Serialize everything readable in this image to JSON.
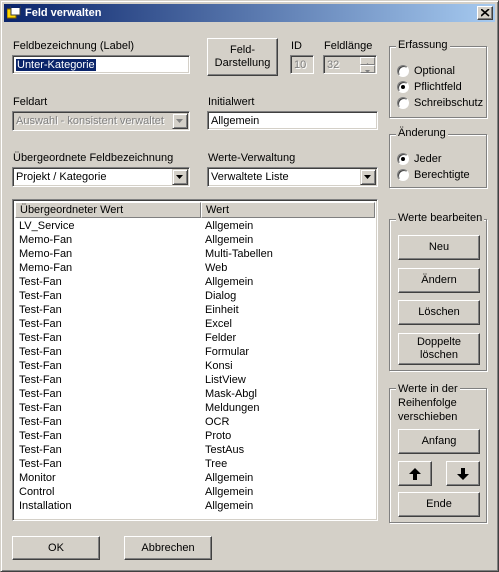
{
  "window": {
    "title": "Feld verwalten"
  },
  "labels": {
    "feldbezeichnung": "Feldbezeichnung (Label)",
    "id": "ID",
    "feldlaenge": "Feldlänge",
    "feldart": "Feldart",
    "initialwert": "Initialwert",
    "uebergeordnete": "Übergeordnete Feldbezeichnung",
    "werteverwaltung": "Werte-Verwaltung"
  },
  "fields": {
    "feldbezeichnung_value": "Unter-Kategorie",
    "id_value": "10",
    "feldlaenge_value": "32",
    "feldart_value": "Auswahl - konsistent verwaltet",
    "initialwert_value": "Allgemein",
    "uebergeordnete_value": "Projekt / Kategorie",
    "werteverwaltung_value": "Verwaltete Liste"
  },
  "buttons": {
    "feld_darstellung_line1": "Feld-",
    "feld_darstellung_line2": "Darstellung",
    "neu": "Neu",
    "aendern": "Ändern",
    "loeschen": "Löschen",
    "doppelte_line1": "Doppelte",
    "doppelte_line2": "löschen",
    "anfang": "Anfang",
    "ende": "Ende",
    "ok": "OK",
    "abbrechen": "Abbrechen"
  },
  "erfassung": {
    "title": "Erfassung",
    "options": [
      {
        "label": "Optional",
        "checked": false
      },
      {
        "label": "Pflichtfeld",
        "checked": true
      },
      {
        "label": "Schreibschutz",
        "checked": false
      }
    ]
  },
  "aenderung": {
    "title": "Änderung",
    "options": [
      {
        "label": "Jeder",
        "checked": true
      },
      {
        "label": "Berechtigte",
        "checked": false
      }
    ]
  },
  "werte_bearbeiten": {
    "title": "Werte bearbeiten"
  },
  "reihenfolge": {
    "title_line1": "Werte in der",
    "title_line2": "Reihenfolge",
    "title_line3": "verschieben"
  },
  "list": {
    "columns": [
      "Übergeordneter Wert",
      "Wert"
    ],
    "rows": [
      [
        "LV_Service",
        "Allgemein"
      ],
      [
        "Memo-Fan",
        "Allgemein"
      ],
      [
        "Memo-Fan",
        "Multi-Tabellen"
      ],
      [
        "Memo-Fan",
        "Web"
      ],
      [
        "Test-Fan",
        "Allgemein"
      ],
      [
        "Test-Fan",
        "Dialog"
      ],
      [
        "Test-Fan",
        "Einheit"
      ],
      [
        "Test-Fan",
        "Excel"
      ],
      [
        "Test-Fan",
        "Felder"
      ],
      [
        "Test-Fan",
        "Formular"
      ],
      [
        "Test-Fan",
        "Konsi"
      ],
      [
        "Test-Fan",
        "ListView"
      ],
      [
        "Test-Fan",
        "Mask-Abgl"
      ],
      [
        "Test-Fan",
        "Meldungen"
      ],
      [
        "Test-Fan",
        "OCR"
      ],
      [
        "Test-Fan",
        "Proto"
      ],
      [
        "Test-Fan",
        "TestAus"
      ],
      [
        "Test-Fan",
        "Tree"
      ],
      [
        "Monitor",
        "Allgemein"
      ],
      [
        "Control",
        "Allgemein"
      ],
      [
        "Installation",
        "Allgemein"
      ]
    ]
  },
  "icons": {
    "title": "app-window-icon",
    "close": "close-icon",
    "dropdown": "chevron-down-icon",
    "up": "arrow-up-icon",
    "down": "arrow-down-icon"
  }
}
